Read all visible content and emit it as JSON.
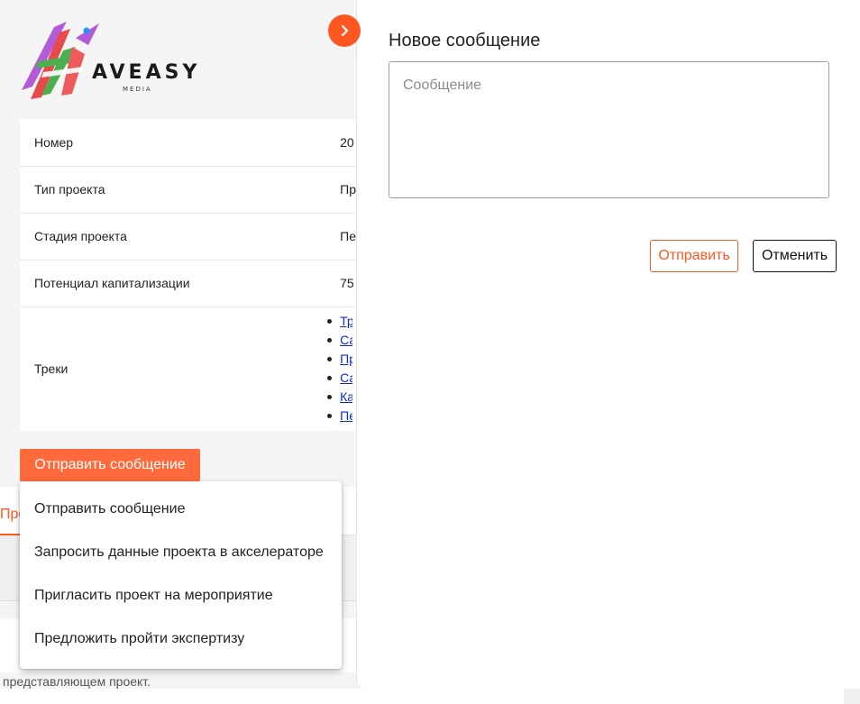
{
  "brand": {
    "name": "AVEASY",
    "sub": "MEDIA",
    "accent": "#ff5722"
  },
  "project_info": {
    "rows": [
      {
        "label": "Номер",
        "value": "20"
      },
      {
        "label": "Тип проекта",
        "value": "Пр"
      },
      {
        "label": "Стадия проекта",
        "value": "Пе"
      },
      {
        "label": "Потенциал капитализации",
        "value": "75"
      }
    ],
    "tracks_label": "Треки",
    "tracks": [
      "Тр",
      "Са",
      "Пр",
      "Са",
      "Ка",
      "Пе"
    ]
  },
  "actions": {
    "send_message_label": "Отправить сообщение"
  },
  "dropdown": {
    "items": [
      "Отправить сообщение",
      "Запросить данные проекта в акселераторе",
      "Пригласить проект на мероприятие",
      "Предложить пройти экспертизу"
    ]
  },
  "tabs": {
    "partial_label": "Про"
  },
  "description_partial": "представляющем проект.",
  "panel": {
    "title": "Новое сообщение",
    "message_placeholder": "Сообщение",
    "message_value": "",
    "send_label": "Отправить",
    "cancel_label": "Отменить",
    "collapse_icon": "chevron-right-icon"
  }
}
